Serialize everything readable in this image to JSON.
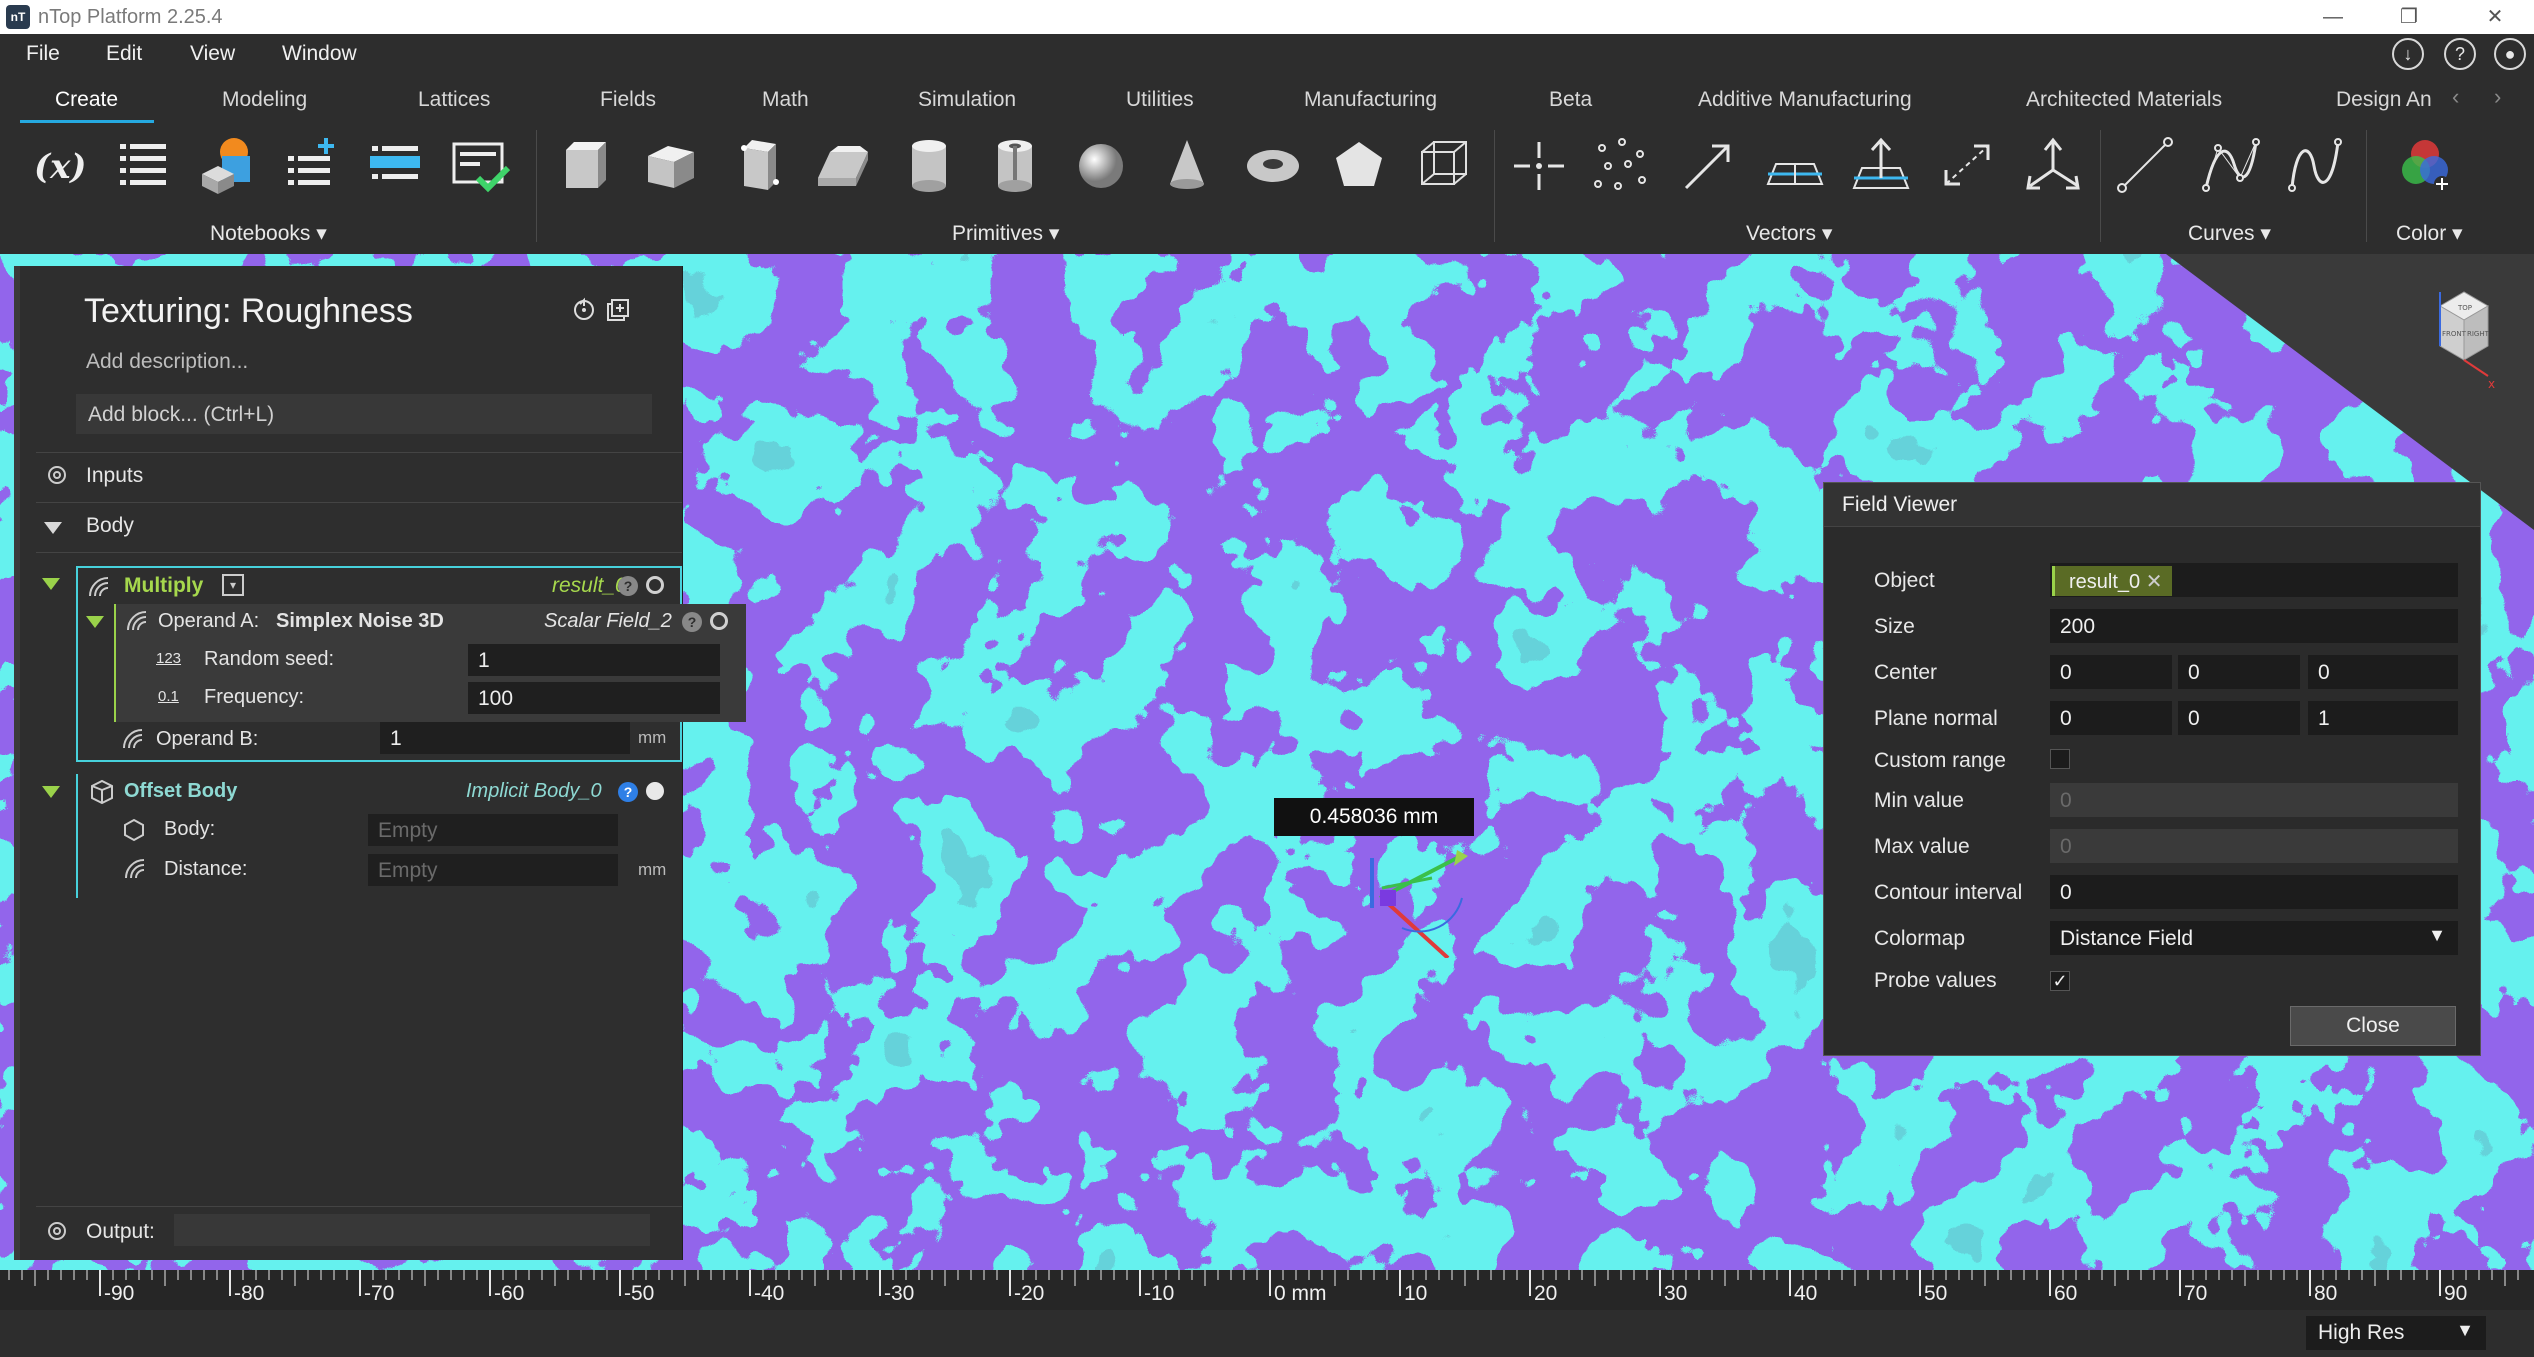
{
  "window": {
    "title": "nTop Platform 2.25.4",
    "controls": [
      "—",
      "❐",
      "✕"
    ]
  },
  "menu": {
    "items": [
      "File",
      "Edit",
      "View",
      "Window"
    ]
  },
  "ribbon": {
    "tabs": [
      "Create",
      "Modeling",
      "Lattices",
      "Fields",
      "Math",
      "Simulation",
      "Utilities",
      "Manufacturing",
      "Beta",
      "Additive Manufacturing",
      "Architected Materials",
      "Design An"
    ],
    "active_tab": "Create",
    "groups": {
      "notebooks": "Notebooks",
      "primitives": "Primitives",
      "vectors": "Vectors",
      "curves": "Curves",
      "color": "Color"
    },
    "variable_icon_text": "(x)"
  },
  "notebook": {
    "title": "Texturing: Roughness",
    "description_placeholder": "Add description...",
    "add_block": "Add block... (Ctrl+L)",
    "inputs_label": "Inputs",
    "body_label": "Body",
    "multiply": {
      "name": "Multiply",
      "result": "result_0",
      "operand_a_label": "Operand A:",
      "operand_a_block": "Simplex Noise 3D",
      "operand_a_type": "Scalar Field_2",
      "random_seed_label": "Random seed:",
      "random_seed_icon": "123",
      "random_seed_value": "1",
      "frequency_label": "Frequency:",
      "frequency_icon": "0.1",
      "frequency_value": "100",
      "operand_b_label": "Operand B:",
      "operand_b_value": "1",
      "operand_b_unit": "mm"
    },
    "offset_body": {
      "name": "Offset Body",
      "type": "Implicit Body_0",
      "body_label": "Body:",
      "body_value": "Empty",
      "distance_label": "Distance:",
      "distance_value": "Empty",
      "distance_unit": "mm"
    },
    "output_label": "Output:"
  },
  "viewport": {
    "measurement": "0.458036 mm",
    "viewcube": {
      "top": "TOP",
      "front": "FRONT",
      "right": "RIGHT",
      "axis_x": "x"
    }
  },
  "field_viewer": {
    "title": "Field Viewer",
    "object_label": "Object",
    "object_value": "result_0",
    "size_label": "Size",
    "size_value": "200",
    "center_label": "Center",
    "center": [
      "0",
      "0",
      "0"
    ],
    "plane_normal_label": "Plane normal",
    "plane_normal": [
      "0",
      "0",
      "1"
    ],
    "custom_range_label": "Custom range",
    "min_label": "Min value",
    "min_value": "0",
    "max_label": "Max value",
    "max_value": "0",
    "contour_label": "Contour interval",
    "contour_value": "0",
    "colormap_label": "Colormap",
    "colormap_value": "Distance Field",
    "probe_label": "Probe values",
    "probe_checked": "✓",
    "close": "Close"
  },
  "ruler": {
    "labels": [
      "-90",
      "-80",
      "-70",
      "-60",
      "-50",
      "-40",
      "-30",
      "-20",
      "-10",
      "0 mm",
      "10",
      "20",
      "30",
      "40",
      "50",
      "60",
      "70",
      "80",
      "90"
    ]
  },
  "status": {
    "resolution": "High Res"
  },
  "colors": {
    "accent_tab": "#25a9e0",
    "block_border": "#47d1dc",
    "block_name": "#a6d84d",
    "field_cyan": "#21e0dc",
    "field_purple": "#4a22d4",
    "field_magenta": "#e0229e"
  }
}
